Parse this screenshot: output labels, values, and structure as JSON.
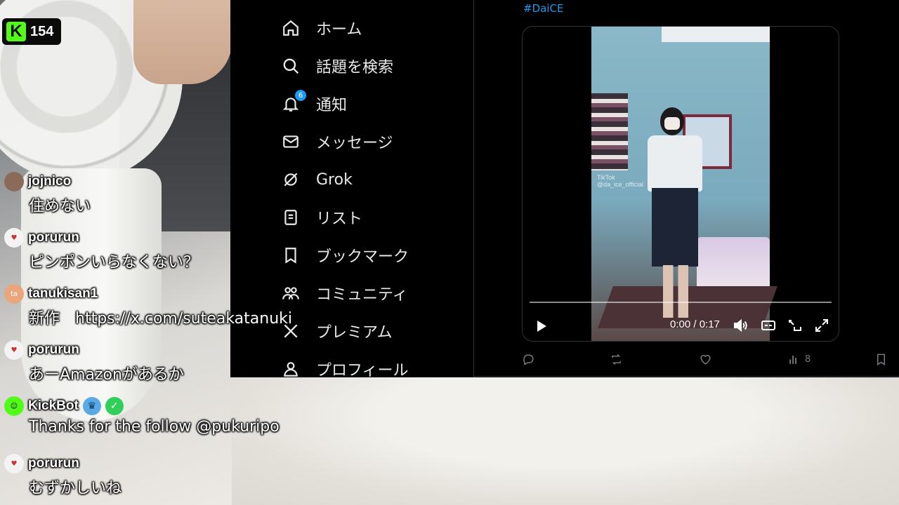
{
  "stream": {
    "viewer_count": "154",
    "platform_logo_letter": "K",
    "accent": "#53fc18"
  },
  "x_nav": {
    "items": [
      {
        "label": "ホーム",
        "icon": "home-icon"
      },
      {
        "label": "話題を検索",
        "icon": "search-icon"
      },
      {
        "label": "通知",
        "icon": "bell-icon",
        "badge": "6"
      },
      {
        "label": "メッセージ",
        "icon": "mail-icon"
      },
      {
        "label": "Grok",
        "icon": "grok-icon"
      },
      {
        "label": "リスト",
        "icon": "list-icon"
      },
      {
        "label": "ブックマーク",
        "icon": "bookmark-icon"
      },
      {
        "label": "コミュニティ",
        "icon": "community-icon"
      },
      {
        "label": "プレミアム",
        "icon": "x-logo-icon"
      },
      {
        "label": "プロフィール",
        "icon": "person-icon"
      }
    ]
  },
  "post": {
    "hashtag": "#DaiCE",
    "video": {
      "time": "0:00 / 0:17",
      "watermark_line1": "TikTok",
      "watermark_line2": "@da_ice_official",
      "progress": 0
    },
    "actions": {
      "views": "8"
    }
  },
  "chat": {
    "messages": [
      {
        "user": "jojnico",
        "text": "住めない",
        "avatar_color": "#8a6a58",
        "avatar_text": ""
      },
      {
        "user": "porurun",
        "text": "ピンポンいらなくない？",
        "avatar_color": "#f3f3f3",
        "avatar_text": ""
      },
      {
        "user": "tanukisan1",
        "text": "新作　https://x.com/suteakatanuki",
        "avatar_color": "#e9a57b",
        "avatar_text": "ta"
      },
      {
        "user": "porurun",
        "text": "あーAmazonがあるか",
        "avatar_color": "#f3f3f3",
        "avatar_text": ""
      },
      {
        "user": "KickBot",
        "text": "Thanks for the follow @pukuripo",
        "avatar_color": "#53fc18",
        "avatar_text": ""
      },
      {
        "user": "porurun",
        "text": "むずかしいね",
        "avatar_color": "#f3f3f3",
        "avatar_text": ""
      }
    ]
  }
}
